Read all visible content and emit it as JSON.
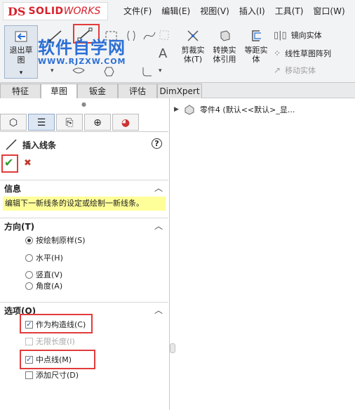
{
  "app": {
    "logo_prefix": "DS",
    "logo_text_bold": "SOLID",
    "logo_text_italic": "WORKS"
  },
  "menu": [
    "文件(F)",
    "编辑(E)",
    "视图(V)",
    "插入(I)",
    "工具(T)",
    "窗口(W)"
  ],
  "ribbon": {
    "exit_sketch": "退出草\n图",
    "dropdown": "▾",
    "trim": "剪裁实\n体(T)",
    "convert": "转换实\n体引用",
    "offset": "等距实\n体",
    "mirror": "镜向实体",
    "pattern": "线性草图阵列",
    "move": "移动实体"
  },
  "watermark": {
    "title": "软件自学网",
    "url": "WWW.RJZXW.COM"
  },
  "tabs": [
    "特征",
    "草图",
    "钣金",
    "评估",
    "DimXpert"
  ],
  "active_tab_index": 1,
  "tree": {
    "item": "零件4 (默认<<默认>_显..."
  },
  "property_manager": {
    "title": "插入线条",
    "help": "?",
    "ok": "✔",
    "cancel": "✖",
    "info": {
      "header": "信息",
      "message": "编辑下一新线条的设定或绘制一新线条。"
    },
    "direction": {
      "header": "方向(T)",
      "options": [
        "按绘制原样(S)",
        "水平(H)",
        "竖直(V)",
        "角度(A)"
      ],
      "selected_index": 0
    },
    "options": {
      "header": "选项(O)",
      "items": [
        {
          "label": "作为构造线(C)",
          "checked": true,
          "disabled": false
        },
        {
          "label": "无限长度(I)",
          "checked": false,
          "disabled": true
        },
        {
          "label": "中点线(M)",
          "checked": true,
          "disabled": false
        },
        {
          "label": "添加尺寸(D)",
          "checked": false,
          "disabled": false
        }
      ]
    }
  },
  "colors": {
    "highlight_red": "#e23b3b",
    "info_yellow": "#ffff99",
    "check_green": "#2f9a2f",
    "watermark_blue": "#2b6fd6"
  }
}
